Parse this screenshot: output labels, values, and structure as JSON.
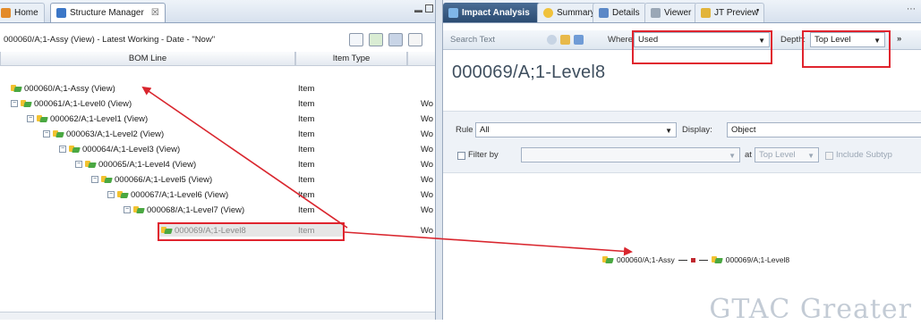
{
  "left_tabs": {
    "home": "Home",
    "structure_manager": "Structure Manager",
    "close_mark": "☒"
  },
  "left_context": "000060/A;1-Assy (View) - Latest Working - Date - \"Now\"",
  "table": {
    "headers": [
      "BOM Line",
      "Item Type"
    ],
    "rows": [
      {
        "label": "000060/A;1-Assy (View)",
        "type": "Item",
        "extra": ""
      },
      {
        "label": "000061/A;1-Level0 (View)",
        "type": "Item",
        "extra": "Wo"
      },
      {
        "label": "000062/A;1-Level1 (View)",
        "type": "Item",
        "extra": "Wo"
      },
      {
        "label": "000063/A;1-Level2 (View)",
        "type": "Item",
        "extra": "Wo"
      },
      {
        "label": "000064/A;1-Level3 (View)",
        "type": "Item",
        "extra": "Wo"
      },
      {
        "label": "000065/A;1-Level4 (View)",
        "type": "Item",
        "extra": "Wo"
      },
      {
        "label": "000066/A;1-Level5 (View)",
        "type": "Item",
        "extra": "Wo"
      },
      {
        "label": "000067/A;1-Level6 (View)",
        "type": "Item",
        "extra": "Wo"
      },
      {
        "label": "000068/A;1-Level7 (View)",
        "type": "Item",
        "extra": "Wo"
      },
      {
        "label": "000069/A;1-Level8",
        "type": "Item",
        "extra": "Wo"
      }
    ]
  },
  "right_tabs": {
    "impact_analysis": "Impact Analysis",
    "close_mark": "x",
    "summary": "Summary",
    "details": "Details",
    "viewer": "Viewer",
    "jt_preview": "JT Preview",
    "overflow": "»"
  },
  "search": {
    "placeholder": "Search Text",
    "where_label": "Where:",
    "where_value": "Used",
    "depth_label": "Depth:",
    "depth_value": "Top Level",
    "more": "»"
  },
  "object_title": "000069/A;1-Level8",
  "filters": {
    "rule_label": "Rule",
    "rule_value": "All",
    "display_label": "Display:",
    "display_value": "Object",
    "filter_by_label": "Filter by",
    "at_label": "at",
    "at_value": "Top Level",
    "include_subtypes": "Include Subtyp"
  },
  "graph": {
    "parent": "000060/A;1-Assy",
    "child": "000069/A;1-Level8"
  },
  "watermark": "GTAC Greater",
  "colors": {
    "highlight": "#e0242e",
    "arrow": "#d9262e",
    "tab_active_dark": "#2c4c72"
  }
}
